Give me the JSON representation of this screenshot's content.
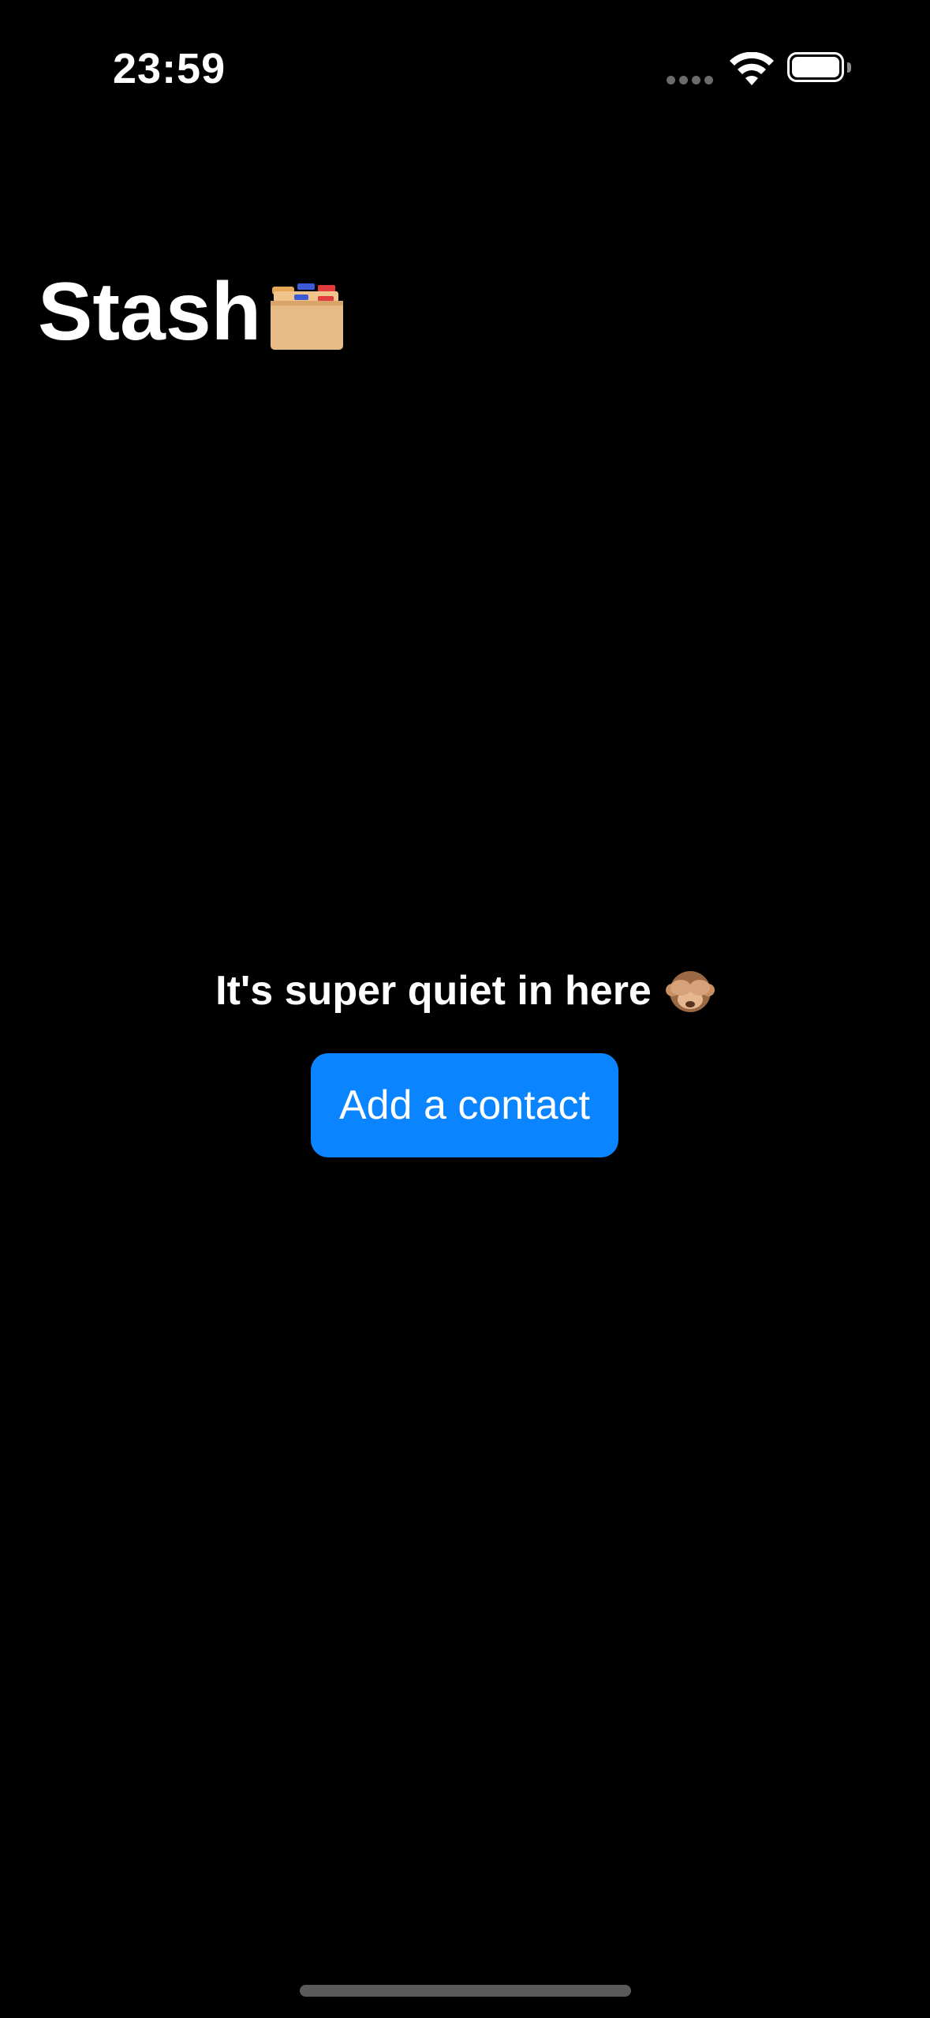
{
  "status_bar": {
    "time": "23:59",
    "signal_icon": "signal-dots-icon",
    "wifi_icon": "wifi-icon",
    "battery_icon": "battery-icon",
    "battery_level": 1.0
  },
  "header": {
    "title": "Stash",
    "title_icon": "card-file-box-icon"
  },
  "empty_state": {
    "message": "It's super quiet in here",
    "message_icon": "see-no-evil-monkey-icon",
    "button_label": "Add a contact"
  },
  "colors": {
    "background": "#000000",
    "accent": "#0a84ff",
    "text": "#ffffff"
  }
}
